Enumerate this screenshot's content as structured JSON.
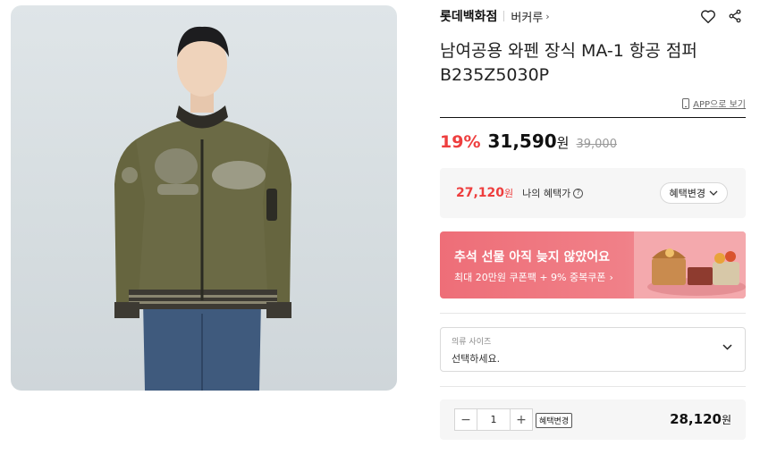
{
  "product": {
    "image_alt": "남여공용 와펜 장식 MA-1 항공 점퍼",
    "brand": "롯데백화점",
    "sub_brand": "버커루",
    "sub_brand_chevron": "›",
    "title_line1": "남여공용 와펜 장식 MA-1 항공 점퍼",
    "title_line2": "B235Z5030P",
    "app_link": "APP으로 보기"
  },
  "price": {
    "discount": "19%",
    "sale": "31,590",
    "won": "원",
    "original": "39,000"
  },
  "benefit": {
    "price": "27,120",
    "won": "원",
    "label": "나의 혜택가",
    "help": "?",
    "button": "혜택변경"
  },
  "banner": {
    "title": "추석 선물 아직 늦지 않았어요",
    "subtitle": "최대 20만원 쿠폰팩 + 9% 중복쿠폰",
    "arrow": "›"
  },
  "size_select": {
    "label": "의류 사이즈",
    "value": "선택하세요."
  },
  "quantity": {
    "minus": "−",
    "value": "1",
    "plus": "+",
    "benefit_tag": "혜택변경",
    "total": "28,120",
    "won": "원"
  },
  "colors": {
    "discount_red": "#ee3e3e",
    "banner_pink": "#ee6e78",
    "jacket_olive": "#6b6a45"
  }
}
